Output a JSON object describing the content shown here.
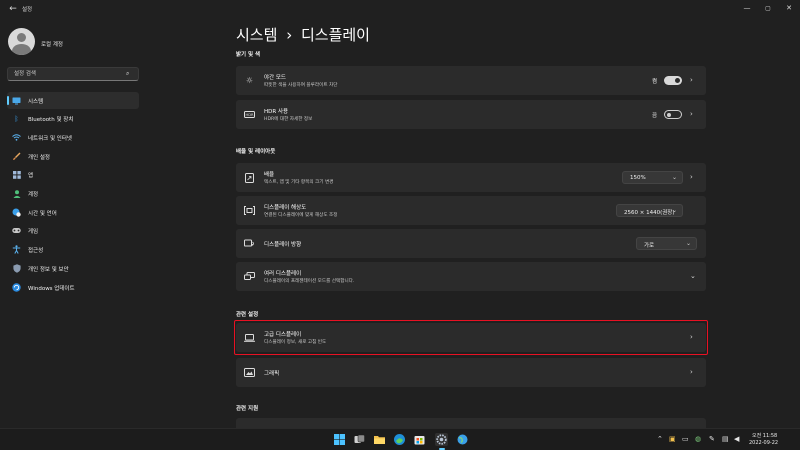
{
  "window": {
    "app_title": "설정"
  },
  "sidebar": {
    "profile_name": "로컬 계정",
    "search_placeholder": "설정 검색",
    "items": [
      {
        "label": "시스템",
        "icon": "monitor-icon",
        "active": true
      },
      {
        "label": "Bluetooth 및 장치",
        "icon": "bluetooth-icon"
      },
      {
        "label": "네트워크 및 인터넷",
        "icon": "wifi-icon"
      },
      {
        "label": "개인 설정",
        "icon": "brush-icon"
      },
      {
        "label": "앱",
        "icon": "apps-icon"
      },
      {
        "label": "계정",
        "icon": "person-icon"
      },
      {
        "label": "시간 및 언어",
        "icon": "globe-clock-icon"
      },
      {
        "label": "게임",
        "icon": "gamepad-icon"
      },
      {
        "label": "접근성",
        "icon": "accessibility-icon"
      },
      {
        "label": "개인 정보 및 보안",
        "icon": "shield-icon"
      },
      {
        "label": "Windows 업데이트",
        "icon": "update-icon"
      }
    ]
  },
  "breadcrumb": {
    "parent": "시스템",
    "separator": "›",
    "current": "디스플레이"
  },
  "sections": {
    "brightness": "밝기 및 색",
    "scale_layout": "배율 및 레이아웃",
    "related_settings": "관련 설정",
    "related_support": "관련 지원"
  },
  "cards": {
    "night_light": {
      "title": "야간 모드",
      "subtitle": "따뜻한 색을 사용하여 블루라이트 차단",
      "toggle_label": "켬"
    },
    "hdr": {
      "title": "HDR 사용",
      "subtitle": "HDR에 대한 자세한 정보",
      "toggle_label": "끔"
    },
    "scale": {
      "title": "배율",
      "subtitle": "텍스트, 앱 및 기타 항목의 크기 변경",
      "value": "150%"
    },
    "resolution": {
      "title": "디스플레이 해상도",
      "subtitle": "연결된 디스플레이에 맞게 해상도 조정",
      "value": "2560 × 1440(권장)"
    },
    "orientation": {
      "title": "디스플레이 방향",
      "value": "가로"
    },
    "multiple_displays": {
      "title": "여러 디스플레이",
      "subtitle": "디스플레이의 프레젠테이션 모드를 선택합니다."
    },
    "advanced_display": {
      "title": "고급 디스플레이",
      "subtitle": "디스플레이 정보, 새로 고침 빈도"
    },
    "graphics": {
      "title": "그래픽"
    }
  },
  "taskbar": {
    "time_period": "오전 11:58",
    "date": "2022-09-22"
  },
  "colors": {
    "accent": "#60cdff",
    "highlight": "#e81123",
    "background": "#202020",
    "card": "#2b2b2b"
  }
}
